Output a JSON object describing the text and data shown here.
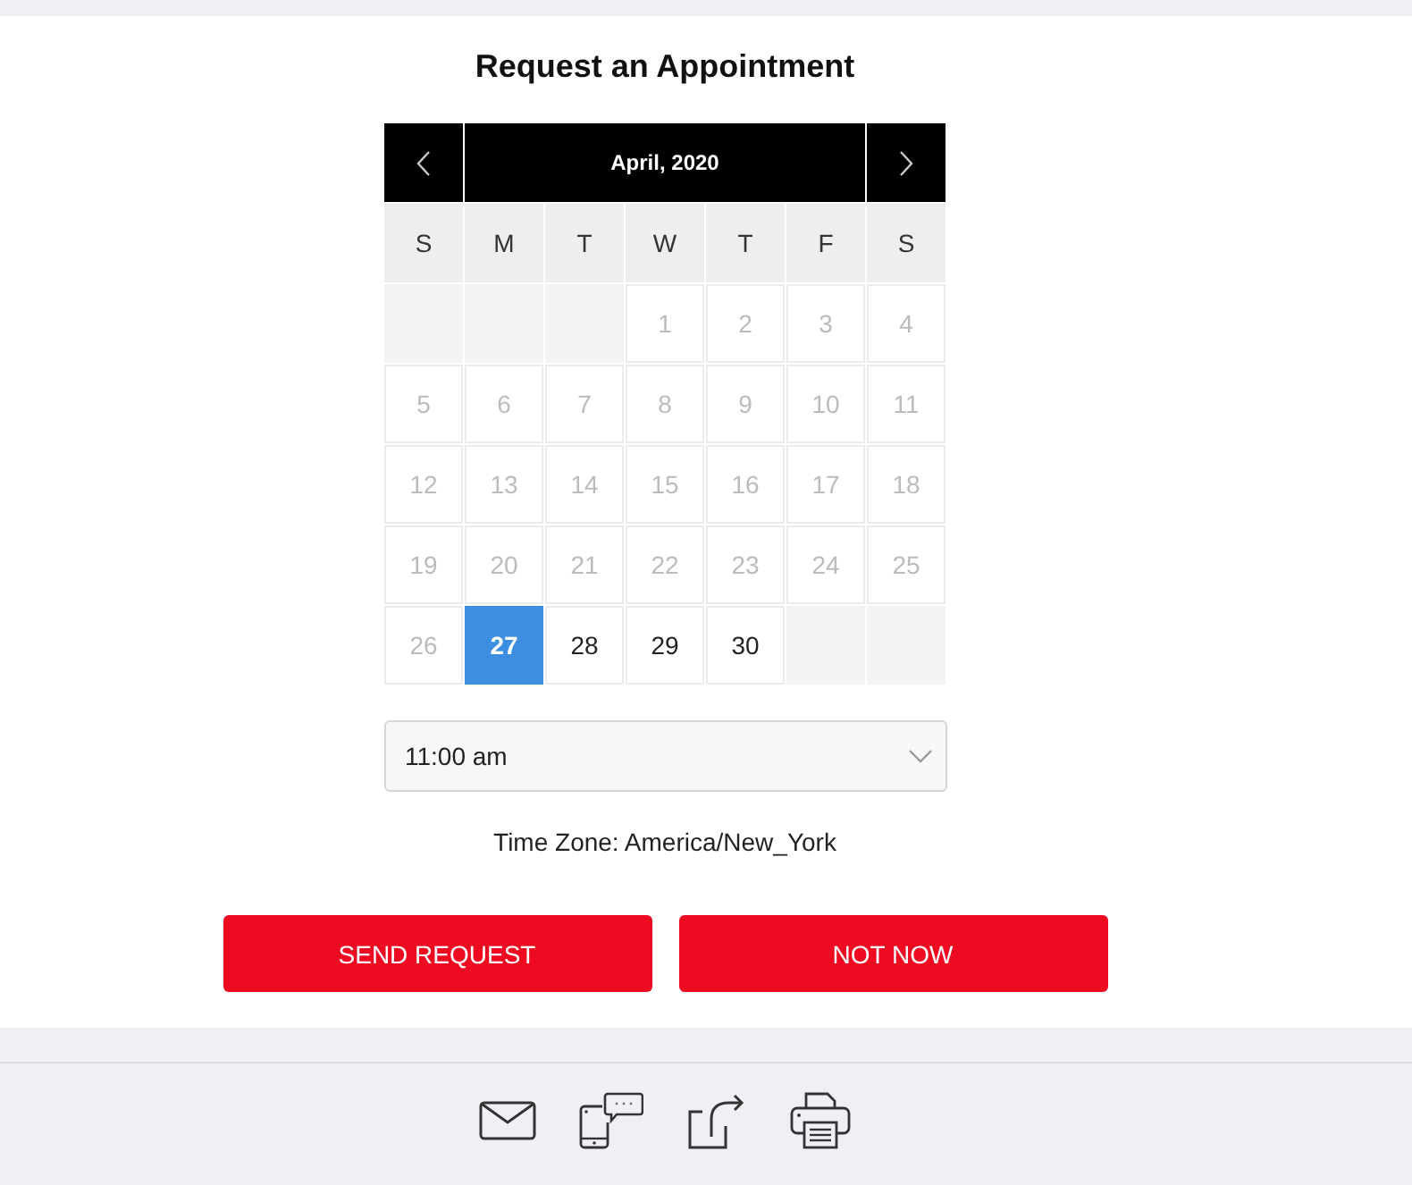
{
  "title": "Request an Appointment",
  "calendar": {
    "month": "April, 2020",
    "weekdays": [
      "S",
      "M",
      "T",
      "W",
      "T",
      "F",
      "S"
    ],
    "weeks": [
      [
        {
          "kind": "blank"
        },
        {
          "kind": "blank"
        },
        {
          "kind": "blank"
        },
        {
          "kind": "day",
          "label": "1",
          "disabled": true,
          "selected": false
        },
        {
          "kind": "day",
          "label": "2",
          "disabled": true,
          "selected": false
        },
        {
          "kind": "day",
          "label": "3",
          "disabled": true,
          "selected": false
        },
        {
          "kind": "day",
          "label": "4",
          "disabled": true,
          "selected": false
        }
      ],
      [
        {
          "kind": "day",
          "label": "5",
          "disabled": true,
          "selected": false
        },
        {
          "kind": "day",
          "label": "6",
          "disabled": true,
          "selected": false
        },
        {
          "kind": "day",
          "label": "7",
          "disabled": true,
          "selected": false
        },
        {
          "kind": "day",
          "label": "8",
          "disabled": true,
          "selected": false
        },
        {
          "kind": "day",
          "label": "9",
          "disabled": true,
          "selected": false
        },
        {
          "kind": "day",
          "label": "10",
          "disabled": true,
          "selected": false
        },
        {
          "kind": "day",
          "label": "11",
          "disabled": true,
          "selected": false
        }
      ],
      [
        {
          "kind": "day",
          "label": "12",
          "disabled": true,
          "selected": false
        },
        {
          "kind": "day",
          "label": "13",
          "disabled": true,
          "selected": false
        },
        {
          "kind": "day",
          "label": "14",
          "disabled": true,
          "selected": false
        },
        {
          "kind": "day",
          "label": "15",
          "disabled": true,
          "selected": false
        },
        {
          "kind": "day",
          "label": "16",
          "disabled": true,
          "selected": false
        },
        {
          "kind": "day",
          "label": "17",
          "disabled": true,
          "selected": false
        },
        {
          "kind": "day",
          "label": "18",
          "disabled": true,
          "selected": false
        }
      ],
      [
        {
          "kind": "day",
          "label": "19",
          "disabled": true,
          "selected": false
        },
        {
          "kind": "day",
          "label": "20",
          "disabled": true,
          "selected": false
        },
        {
          "kind": "day",
          "label": "21",
          "disabled": true,
          "selected": false
        },
        {
          "kind": "day",
          "label": "22",
          "disabled": true,
          "selected": false
        },
        {
          "kind": "day",
          "label": "23",
          "disabled": true,
          "selected": false
        },
        {
          "kind": "day",
          "label": "24",
          "disabled": true,
          "selected": false
        },
        {
          "kind": "day",
          "label": "25",
          "disabled": true,
          "selected": false
        }
      ],
      [
        {
          "kind": "day",
          "label": "26",
          "disabled": true,
          "selected": false
        },
        {
          "kind": "day",
          "label": "27",
          "disabled": false,
          "selected": true
        },
        {
          "kind": "day",
          "label": "28",
          "disabled": false,
          "selected": false
        },
        {
          "kind": "day",
          "label": "29",
          "disabled": false,
          "selected": false
        },
        {
          "kind": "day",
          "label": "30",
          "disabled": false,
          "selected": false
        },
        {
          "kind": "blank"
        },
        {
          "kind": "blank"
        }
      ]
    ]
  },
  "time_select": {
    "value": "11:00 am"
  },
  "time_zone": "Time Zone: America/New_York",
  "buttons": [
    {
      "label": "SEND REQUEST"
    },
    {
      "label": "NOT NOW"
    }
  ]
}
